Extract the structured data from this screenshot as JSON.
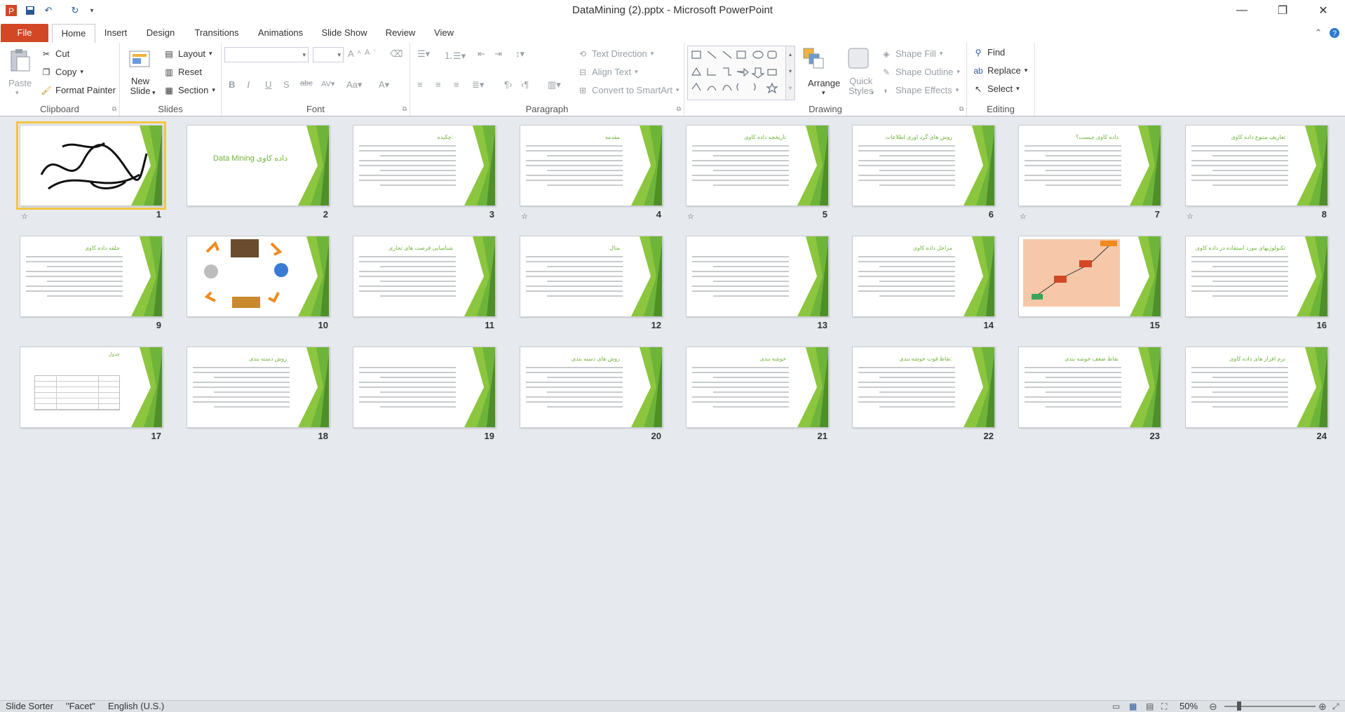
{
  "window": {
    "title": "DataMining (2).pptx - Microsoft PowerPoint",
    "minimize": "—",
    "restore": "❐",
    "close": "✕"
  },
  "tabs": [
    "File",
    "Home",
    "Insert",
    "Design",
    "Transitions",
    "Animations",
    "Slide Show",
    "Review",
    "View"
  ],
  "clipboard": {
    "paste": "Paste",
    "cut": "Cut",
    "copy": "Copy",
    "format_painter": "Format Painter",
    "label": "Clipboard"
  },
  "slides_group": {
    "new_slide": "New Slide",
    "layout": "Layout",
    "reset": "Reset",
    "section": "Section",
    "label": "Slides"
  },
  "font_group": {
    "label": "Font"
  },
  "paragraph_group": {
    "text_direction": "Text Direction",
    "align_text": "Align Text",
    "convert_smartart": "Convert to SmartArt",
    "label": "Paragraph"
  },
  "drawing_group": {
    "arrange": "Arrange",
    "quick_styles": "Quick Styles",
    "shape_fill": "Shape Fill",
    "shape_outline": "Shape Outline",
    "shape_effects": "Shape Effects",
    "label": "Drawing"
  },
  "editing_group": {
    "find": "Find",
    "replace": "Replace",
    "select": "Select",
    "label": "Editing"
  },
  "slides": [
    {
      "num": "1",
      "title": "",
      "kind": "calligraphy",
      "anim": true
    },
    {
      "num": "2",
      "title": "Data Mining داده کاوی",
      "kind": "titleslide",
      "anim": false
    },
    {
      "num": "3",
      "title": "چکیده:",
      "kind": "text",
      "anim": false
    },
    {
      "num": "4",
      "title": "مقدمه",
      "kind": "text",
      "anim": true
    },
    {
      "num": "5",
      "title": "تاریخچه داده کاوی",
      "kind": "text",
      "anim": true
    },
    {
      "num": "6",
      "title": "روش های گرد آوری اطلاعات",
      "kind": "text",
      "anim": false
    },
    {
      "num": "7",
      "title": "داده کاوی چیست؟",
      "kind": "text",
      "anim": true
    },
    {
      "num": "8",
      "title": "تعاریف متنوع داده کاوی",
      "kind": "text",
      "anim": true
    },
    {
      "num": "9",
      "title": "حلقه داده کاوی",
      "kind": "text",
      "anim": false
    },
    {
      "num": "10",
      "title": "",
      "kind": "diagram",
      "anim": false
    },
    {
      "num": "11",
      "title": "شناسایی فرصت های تجاری",
      "kind": "text",
      "anim": false
    },
    {
      "num": "12",
      "title": "مثال",
      "kind": "text",
      "anim": false
    },
    {
      "num": "13",
      "title": "",
      "kind": "text",
      "anim": false
    },
    {
      "num": "14",
      "title": "مراحل داده کاوی",
      "kind": "text",
      "anim": false
    },
    {
      "num": "15",
      "title": "",
      "kind": "pyramid",
      "anim": false
    },
    {
      "num": "16",
      "title": "تکنولوژیهای مورد استفاده در داده کاوی",
      "kind": "text",
      "anim": false
    },
    {
      "num": "17",
      "title": "جدول",
      "kind": "table",
      "anim": false
    },
    {
      "num": "18",
      "title": "روش دسته بندی",
      "kind": "text",
      "anim": false
    },
    {
      "num": "19",
      "title": "",
      "kind": "text",
      "anim": false
    },
    {
      "num": "20",
      "title": "روش های دسته بندی",
      "kind": "text",
      "anim": false
    },
    {
      "num": "21",
      "title": "خوشه بندی",
      "kind": "text",
      "anim": false
    },
    {
      "num": "22",
      "title": "نقاط قوت خوشه بندی:",
      "kind": "text",
      "anim": false
    },
    {
      "num": "23",
      "title": "نقاط ضعف خوشه بندی",
      "kind": "text",
      "anim": false
    },
    {
      "num": "24",
      "title": "نرم افزار های داده کاوی",
      "kind": "text",
      "anim": false
    }
  ],
  "status": {
    "view": "Slide Sorter",
    "theme": "\"Facet\"",
    "language": "English (U.S.)",
    "zoom": "50%"
  },
  "colors": {
    "file_tab": "#d24726",
    "accent_green": "#6fb43a",
    "selection": "#f3c545"
  }
}
